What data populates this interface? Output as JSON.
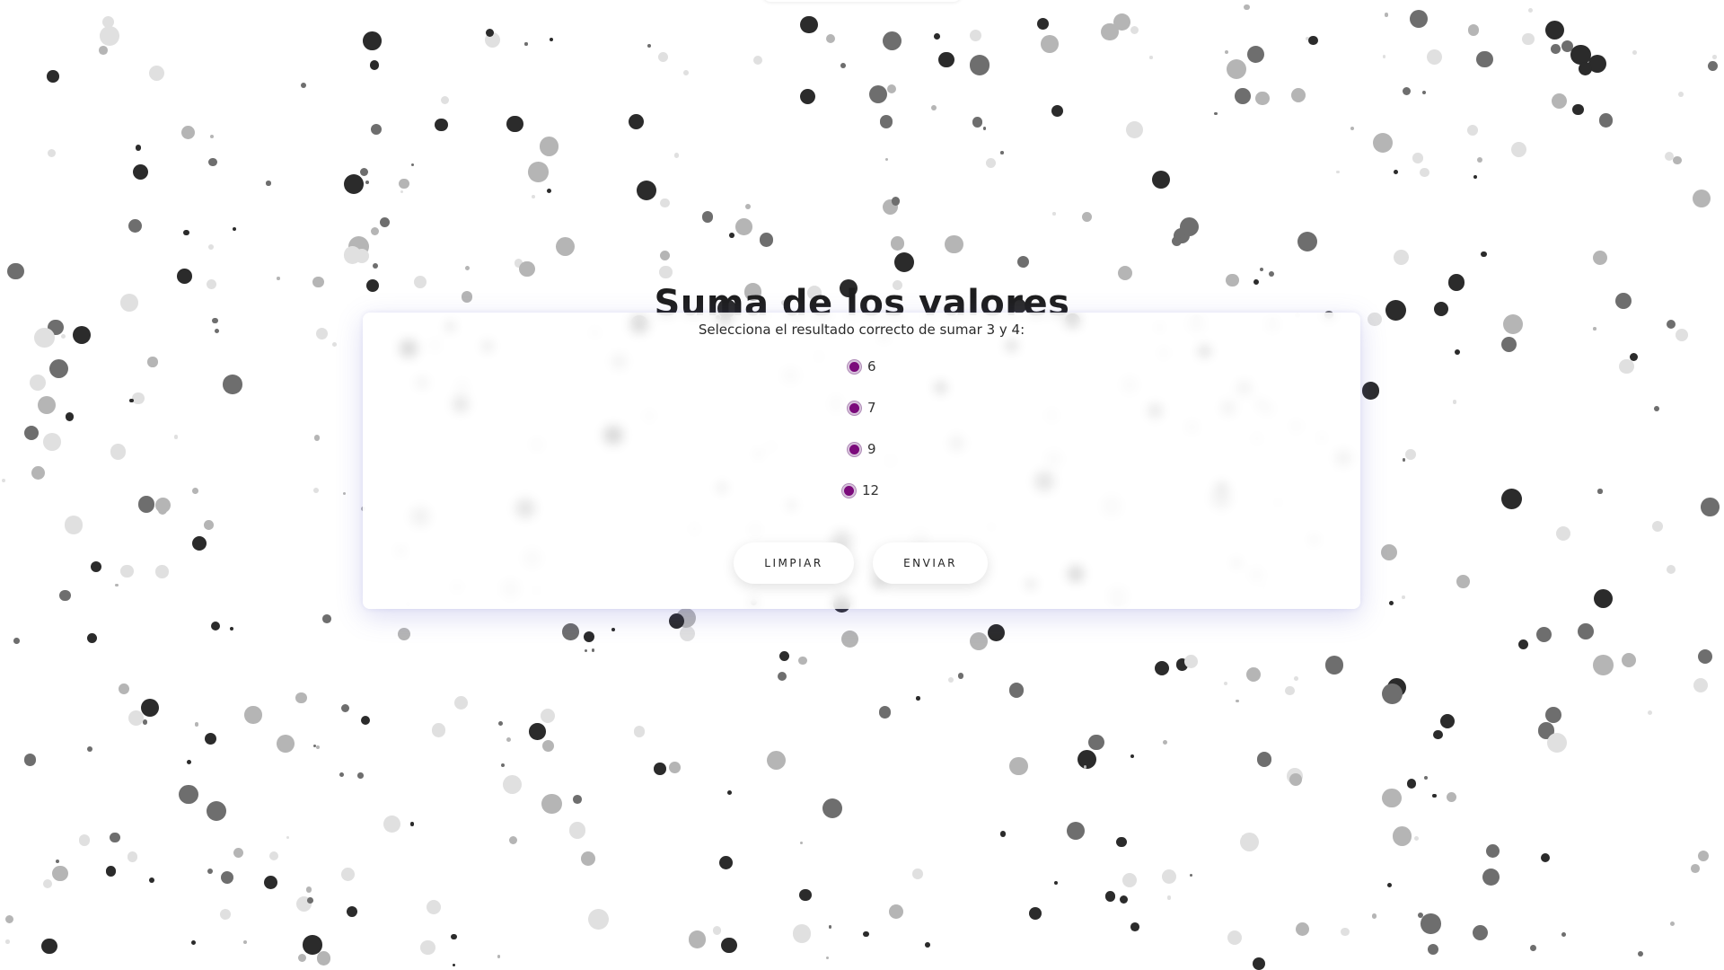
{
  "page": {
    "title": "Suma de los valores"
  },
  "quiz": {
    "question": "Selecciona el resultado correcto de sumar 3 y 4:",
    "options": [
      {
        "label": "6"
      },
      {
        "label": "7"
      },
      {
        "label": "9"
      },
      {
        "label": "12"
      }
    ],
    "radio_color": "#7b0a7b"
  },
  "actions": {
    "clear_label": "LIMPIAR",
    "submit_label": "ENVIAR"
  },
  "background": {
    "pattern": "scattered-grey-dots",
    "colors": [
      "#2b2b2b",
      "#6e6e6e",
      "#b5b5b5",
      "#e0e0e0"
    ]
  }
}
